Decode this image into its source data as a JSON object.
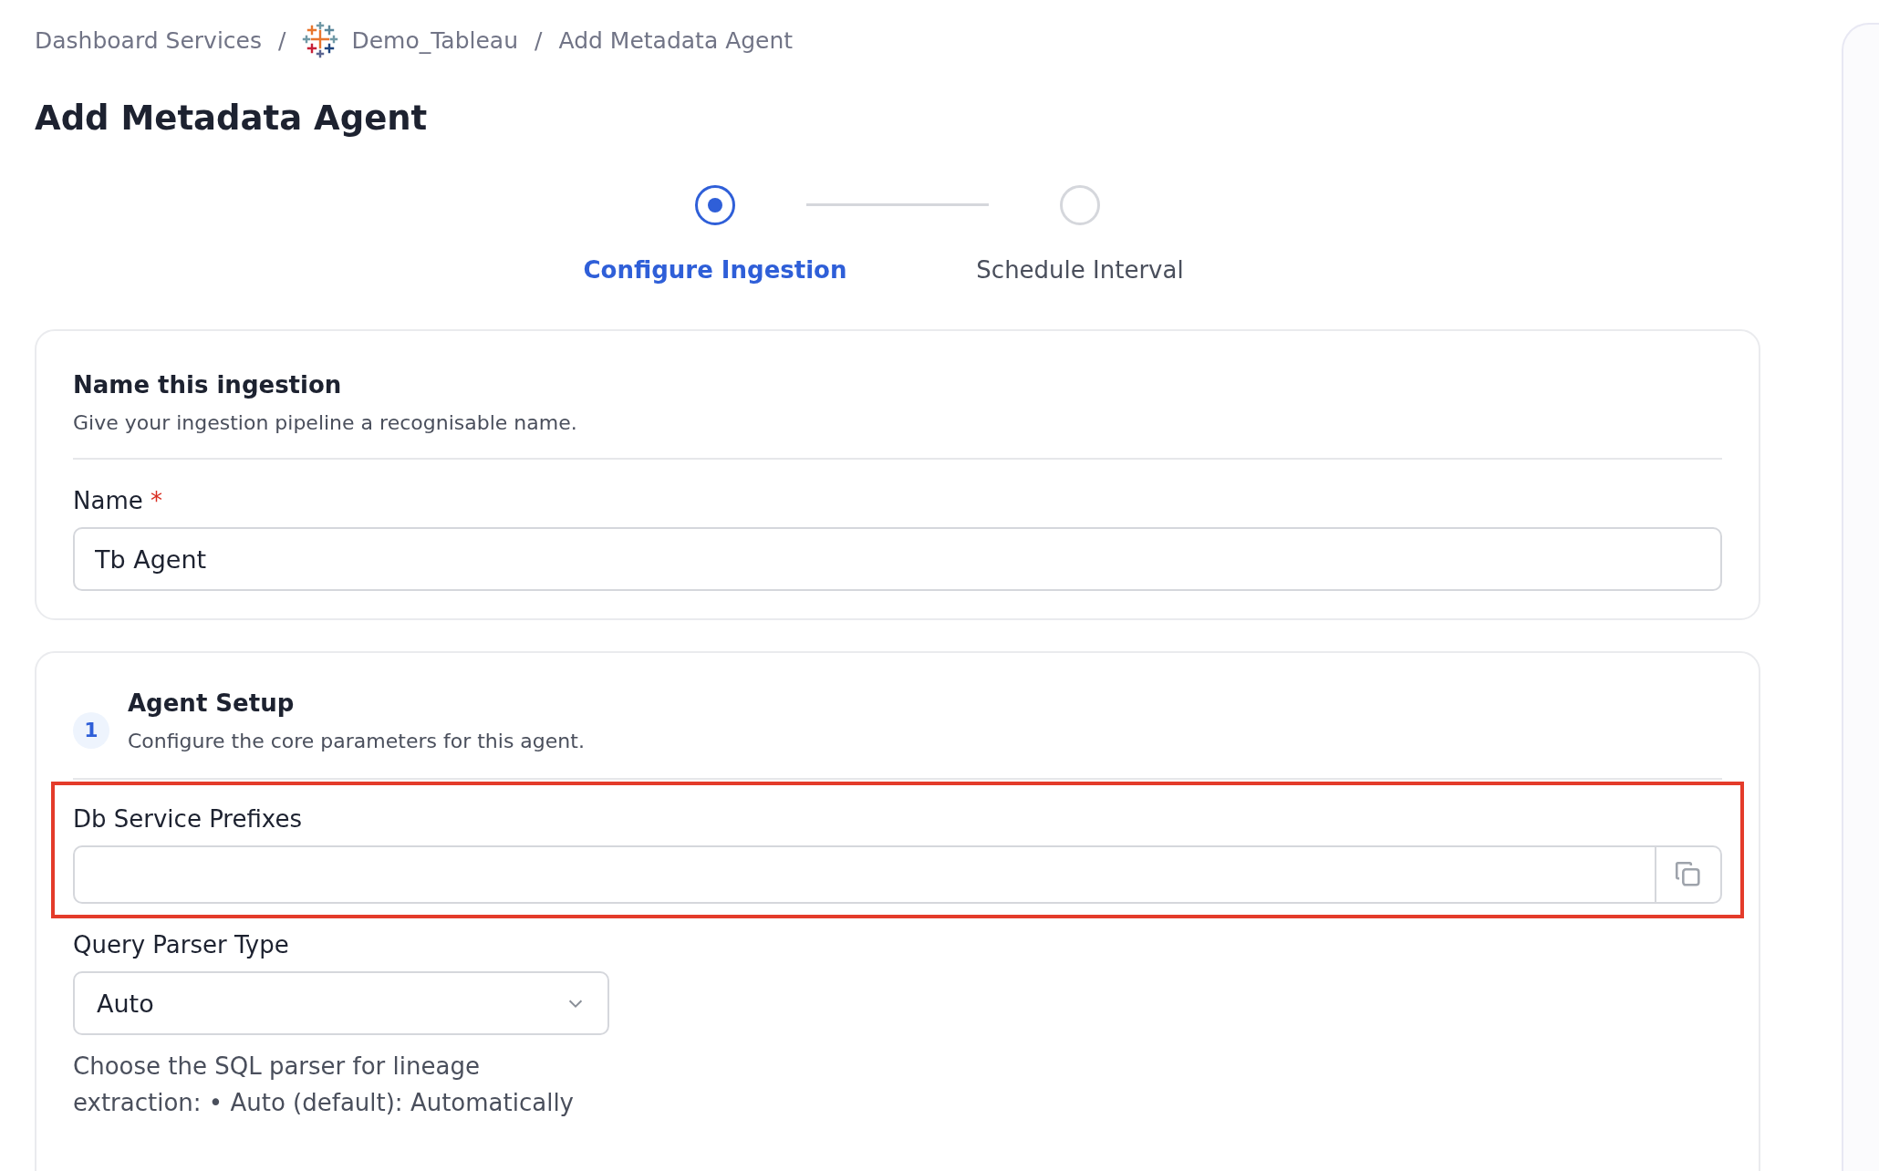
{
  "breadcrumb": [
    {
      "label": "Dashboard Services",
      "icon": false
    },
    {
      "label": "Demo_Tableau",
      "icon": true
    },
    {
      "label": "Add Metadata Agent",
      "icon": false
    }
  ],
  "separator": "/",
  "title": "Add Metadata Agent",
  "steps": [
    {
      "label": "Configure Ingestion",
      "selected": true
    },
    {
      "label": "Schedule Interval",
      "selected": false
    }
  ],
  "name_card": {
    "title": "Name this ingestion",
    "subtitle": "Give your ingestion pipeline a recognisable name.",
    "field_label": "Name",
    "required_mark": "*",
    "value": "Tb Agent"
  },
  "setup_card": {
    "number": "1",
    "title": "Agent Setup",
    "subtitle": "Configure the core parameters for this agent.",
    "fields": [
      {
        "kind": "list",
        "label": "Db Service Prefixes",
        "highlighted": true
      },
      {
        "kind": "select",
        "label": "Query Parser Type",
        "value": "Auto",
        "help_lines": [
          "Choose the SQL parser for lineage",
          "extraction: • Auto (default): Automatically"
        ]
      }
    ]
  }
}
